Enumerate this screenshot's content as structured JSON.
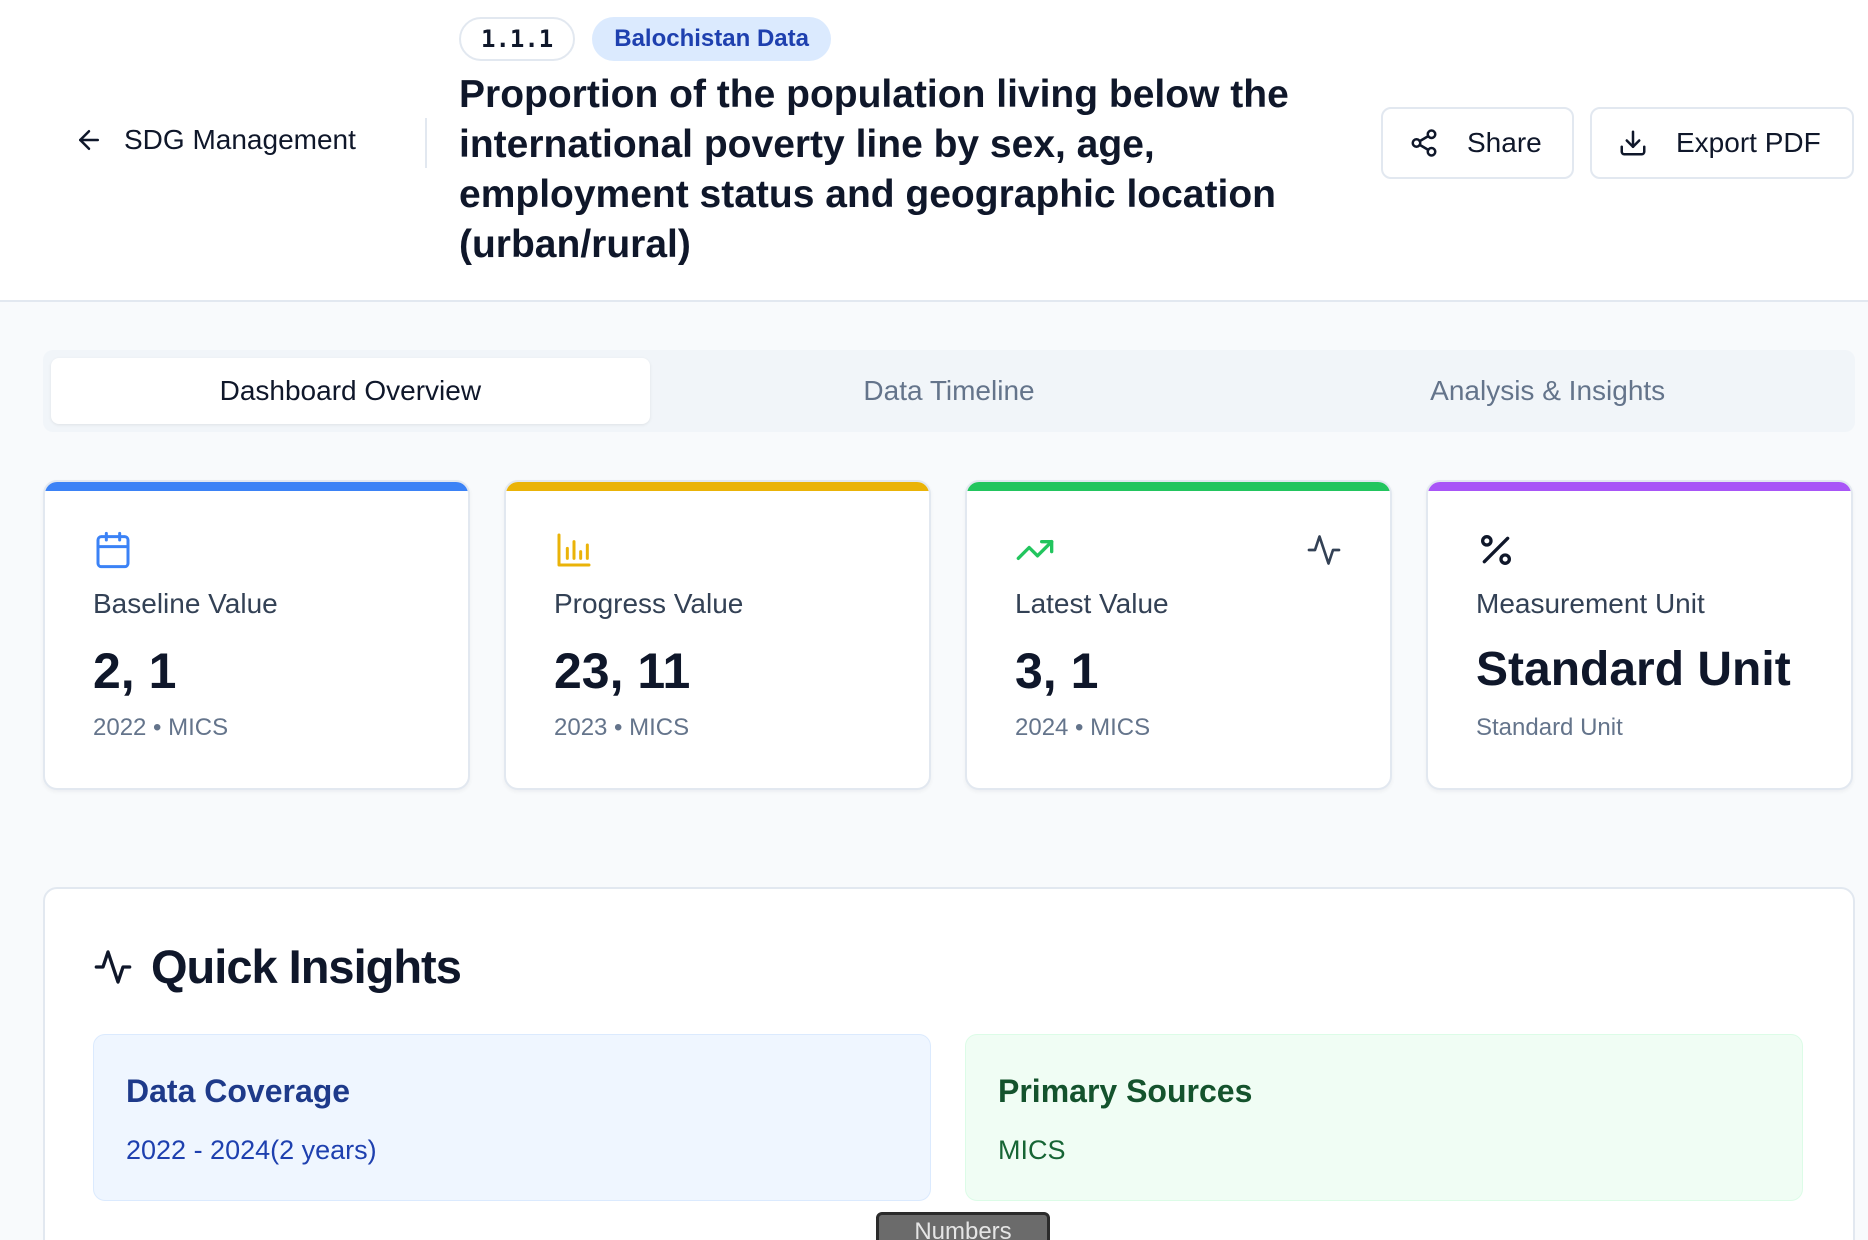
{
  "header": {
    "back_label": "SDG Management",
    "indicator_code": "1.1.1",
    "region_badge": "Balochistan Data",
    "title": "Proportion of the population living below the international poverty line by sex, age, employment status and geographic location (urban/rural)",
    "share_label": "Share",
    "export_label": "Export PDF"
  },
  "tabs": [
    {
      "label": "Dashboard Overview",
      "active": true
    },
    {
      "label": "Data Timeline",
      "active": false
    },
    {
      "label": "Analysis & Insights",
      "active": false
    }
  ],
  "cards": [
    {
      "label": "Baseline Value",
      "value": "2, 1",
      "year": "2022",
      "source": "MICS",
      "meta": "2022 • MICS",
      "accent": "#3b82f6",
      "icon": "calendar-icon"
    },
    {
      "label": "Progress Value",
      "value": "23, 11",
      "year": "2023",
      "source": "MICS",
      "meta": "2023 • MICS",
      "accent": "#eab308",
      "icon": "bar-chart-icon"
    },
    {
      "label": "Latest Value",
      "value": "3, 1",
      "year": "2024",
      "source": "MICS",
      "meta": "2024 • MICS",
      "accent": "#22c55e",
      "icon": "trending-up-icon",
      "secondary_icon": "activity-icon"
    },
    {
      "label": "Measurement Unit",
      "value": "Standard Unit",
      "meta": "Standard Unit",
      "accent": "#a855f7",
      "icon": "percent-icon"
    }
  ],
  "insights": {
    "title": "Quick Insights",
    "coverage": {
      "title": "Data Coverage",
      "value": "2022 - 2024(2 years)"
    },
    "sources": {
      "title": "Primary Sources",
      "value": "MICS"
    }
  },
  "tooltip": {
    "text": "Numbers"
  }
}
